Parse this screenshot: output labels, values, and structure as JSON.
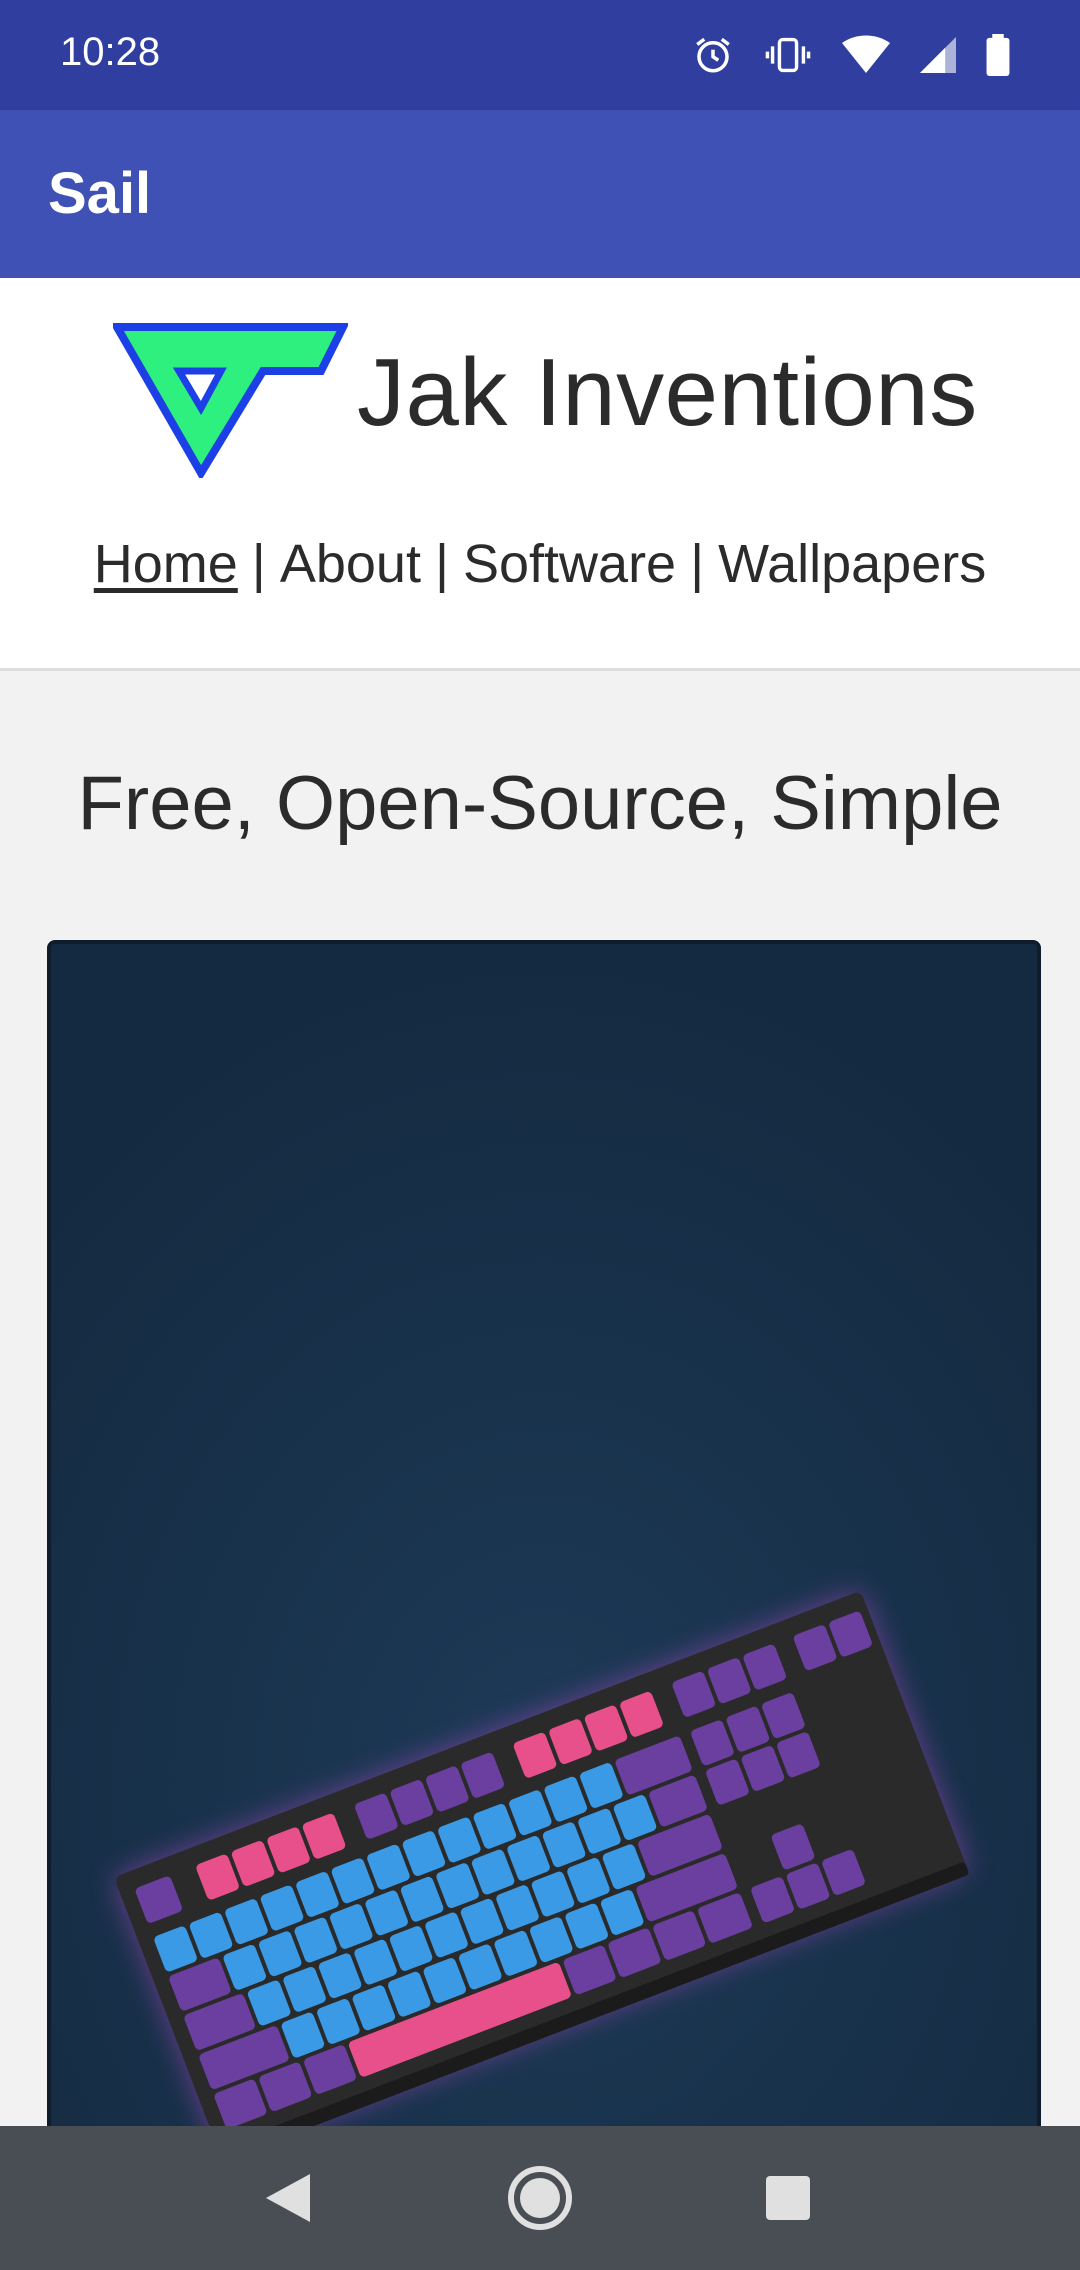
{
  "status_bar": {
    "time": "10:28",
    "icons": [
      "alarm-icon",
      "vibrate-icon",
      "wifi-icon",
      "signal-icon",
      "battery-icon"
    ]
  },
  "app_bar": {
    "title": "Sail"
  },
  "site": {
    "title": "Jak Inventions",
    "nav": {
      "home": "Home",
      "about": "About",
      "software": "Software",
      "wallpapers": "Wallpapers",
      "separator": "|"
    },
    "hero_title": "Free, Open-Source, Simple"
  },
  "colors": {
    "status_bar": "#303f9f",
    "app_bar": "#3f51b5",
    "logo_green": "#2ef07e",
    "logo_blue": "#1c3fe6",
    "wallpaper_bg": "#162d44",
    "key_pink": "#e8508c",
    "key_blue": "#3a9ae6",
    "key_purple": "#6b3fa0"
  },
  "navigation_bar": {
    "icons": [
      "back-icon",
      "home-icon",
      "recents-icon"
    ]
  }
}
